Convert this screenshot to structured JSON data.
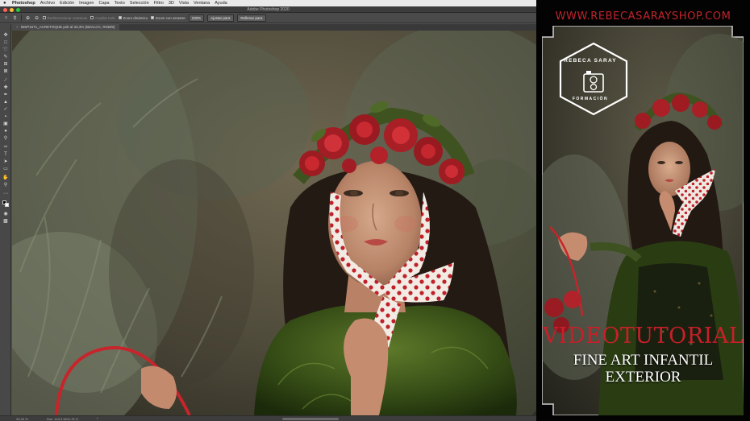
{
  "menubar": {
    "app": "Photoshop",
    "items": [
      "Archivo",
      "Edición",
      "Imagen",
      "Capa",
      "Texto",
      "Selección",
      "Filtro",
      "3D",
      "Vista",
      "Ventana",
      "Ayuda"
    ]
  },
  "window": {
    "title": "Adobe Photoshop 2020"
  },
  "options_bar": {
    "dynamic_zoom_label": "Redimensionar ventanas",
    "zoom_all_label": "Zoom dinámico",
    "resize_windows_label": "Ampliar todo",
    "zoom_all_windows_label": "Zoom con arrastre",
    "fit_button": "100%",
    "fit_screen_button": "Ajustar pant.",
    "fill_screen_button": "Rellenar pant."
  },
  "document_tab": {
    "label": "INSP1671_ACRETOQUE.psb al 33,3% (BZALCC, RGB/8)"
  },
  "status_bar": {
    "zoom": "33,33 %",
    "doc_info": "Doc: 143,3 M/11,75 G"
  },
  "promo": {
    "url": "WWW.REBECASARAYSHOP.COM",
    "badge_top": "REBECA SARAY",
    "badge_bottom": "FORMACIÓN",
    "video_label": "VIDEOTUTORIAL",
    "title_line1": "FINE ART INFANTIL",
    "title_line2": "EXTERIOR"
  },
  "colors": {
    "brand_red": "#c81f2a",
    "ps_panel": "#535353",
    "close": "#ff5f57",
    "minimize": "#febc2e",
    "zoom": "#28c840"
  },
  "icons": {
    "toolbar": [
      "move-icon",
      "marquee-icon",
      "lasso-icon",
      "quick-select-icon",
      "crop-icon",
      "frame-icon",
      "eyedropper-icon",
      "healing-icon",
      "brush-icon",
      "stamp-icon",
      "history-brush-icon",
      "eraser-icon",
      "gradient-icon",
      "blur-icon",
      "dodge-icon",
      "pen-icon",
      "type-icon",
      "path-select-icon",
      "rectangle-icon",
      "hand-icon",
      "zoom-icon",
      "more-tools-icon",
      "swap-colors-icon",
      "quickmask-icon",
      "screen-mode-icon"
    ]
  }
}
